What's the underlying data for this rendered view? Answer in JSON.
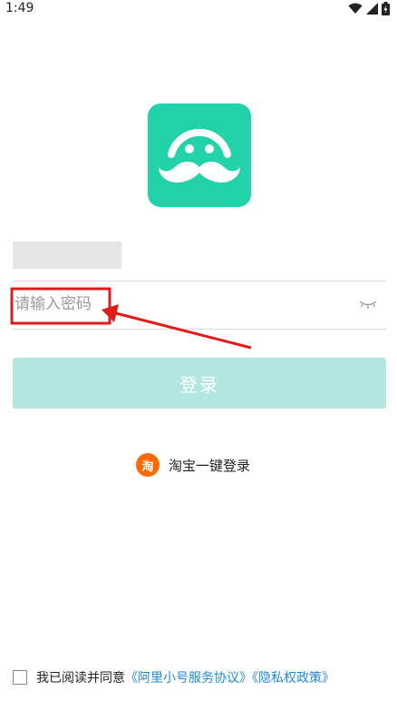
{
  "status_bar": {
    "time": "1:49"
  },
  "login_form": {
    "password_placeholder": "请输入密码",
    "login_label": "登录",
    "taobao_icon_glyph": "淘",
    "taobao_label": "淘宝一键登录"
  },
  "agreement": {
    "prefix": "我已阅读并同意",
    "link1": "《阿里小号服务协议》",
    "link2": "《隐私权政策》"
  },
  "colors": {
    "brand": "#22d2a8",
    "login_button": "#b2e7e1",
    "taobao": "#ff6a00",
    "link": "#1f8ad7",
    "annotation": "#e01b1b"
  }
}
